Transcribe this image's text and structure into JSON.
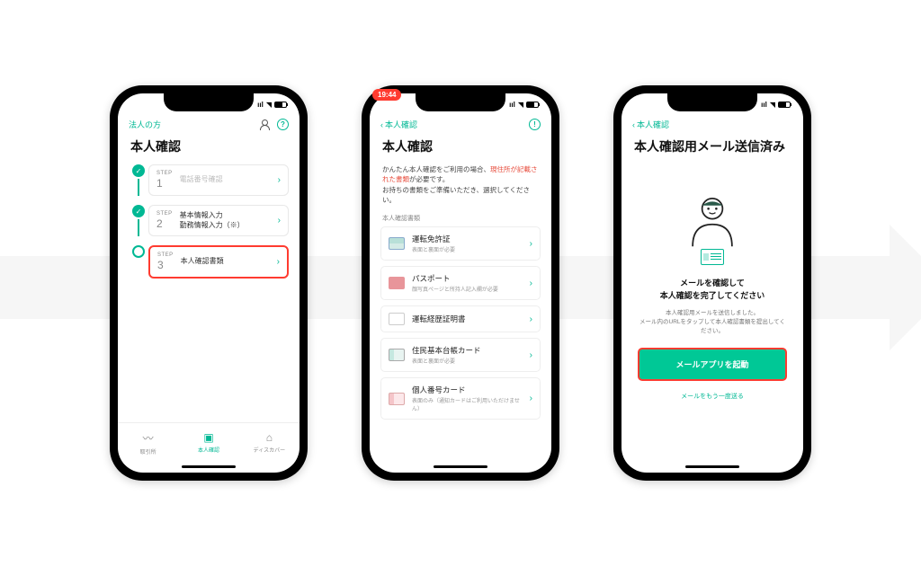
{
  "colors": {
    "accent": "#00b894",
    "error": "#ff3b30"
  },
  "phone1": {
    "topnav_left": "法人の方",
    "title": "本人確認",
    "steps": [
      {
        "label": "STEP",
        "num": "1",
        "text": "電話番号確認",
        "done": true,
        "muted": true
      },
      {
        "label": "STEP",
        "num": "2",
        "text": "基本情報入力\n勤務情報入力（※）",
        "done": true
      },
      {
        "label": "STEP",
        "num": "3",
        "text": "本人確認書類",
        "done": false,
        "highlight": true
      }
    ],
    "tabs": [
      {
        "label": "取引所",
        "icon": "〰"
      },
      {
        "label": "本人確認",
        "icon": "▣",
        "active": true
      },
      {
        "label": "ディスカバー",
        "icon": "⌂"
      }
    ]
  },
  "phone2": {
    "time": "19:44",
    "back": "本人確認",
    "title": "本人確認",
    "desc_pre": "かんたん本人確認をご利用の場合、",
    "desc_red": "現住所が記載された書類",
    "desc_post": "が必要です。\nお持ちの書類をご準備いただき、選択してください。",
    "section": "本人確認書類",
    "docs": [
      {
        "title": "運転免許証",
        "sub": "表面と裏面が必要",
        "icon": "license"
      },
      {
        "title": "パスポート",
        "sub": "顔写真ページと所持人記入欄が必要",
        "icon": "passport"
      },
      {
        "title": "運転経歴証明書",
        "sub": "",
        "icon": "cert"
      },
      {
        "title": "住民基本台帳カード",
        "sub": "表面と裏面が必要",
        "icon": "juki"
      },
      {
        "title": "個人番号カード",
        "sub": "表面のみ（通知カードはご利用いただけません）",
        "icon": "my"
      }
    ]
  },
  "phone3": {
    "back": "本人確認",
    "title": "本人確認用メール送信済み",
    "msg_title": "メールを確認して\n本人確認を完了してください",
    "msg_sub": "本人確認用メールを送信しました。\nメール内のURLをタップして本人確認書類を提出してください。",
    "button": "メールアプリを起動",
    "resend": "メールをもう一度送る"
  }
}
